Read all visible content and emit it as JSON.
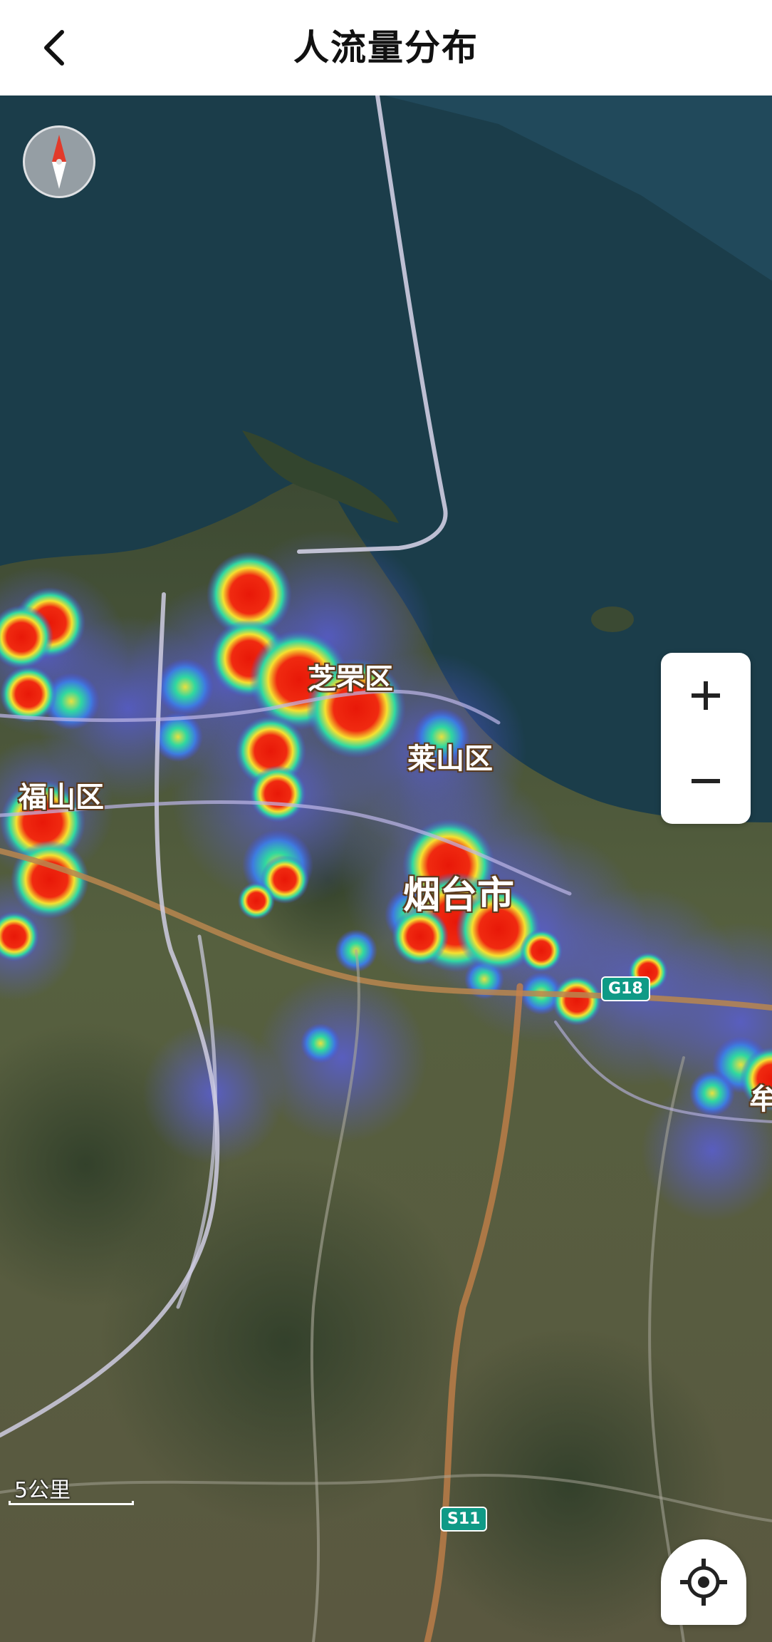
{
  "header": {
    "title": "人流量分布"
  },
  "map": {
    "labels": {
      "zhifu": "芝罘区",
      "laishan": "莱山区",
      "fushan": "福山区",
      "yantai": "烟台市",
      "mu": "牟"
    },
    "roads": {
      "g18": "G18",
      "s11": "S11"
    },
    "scale": "5公里",
    "colors": {
      "sea": "#1b3d4a",
      "land": "#4d5a3c",
      "heat_low": "#4a55e0",
      "heat_mid": "#27d6a0",
      "heat_high": "#e8e030",
      "heat_peak": "#e82010",
      "highway": "#c8824a",
      "road": "#d8d6e8"
    }
  },
  "controls": {
    "zoom_in_icon": "plus-icon",
    "zoom_out_icon": "minus-icon",
    "compass_icon": "compass-icon",
    "locate_icon": "crosshair-icon",
    "back_icon": "chevron-left-icon"
  }
}
